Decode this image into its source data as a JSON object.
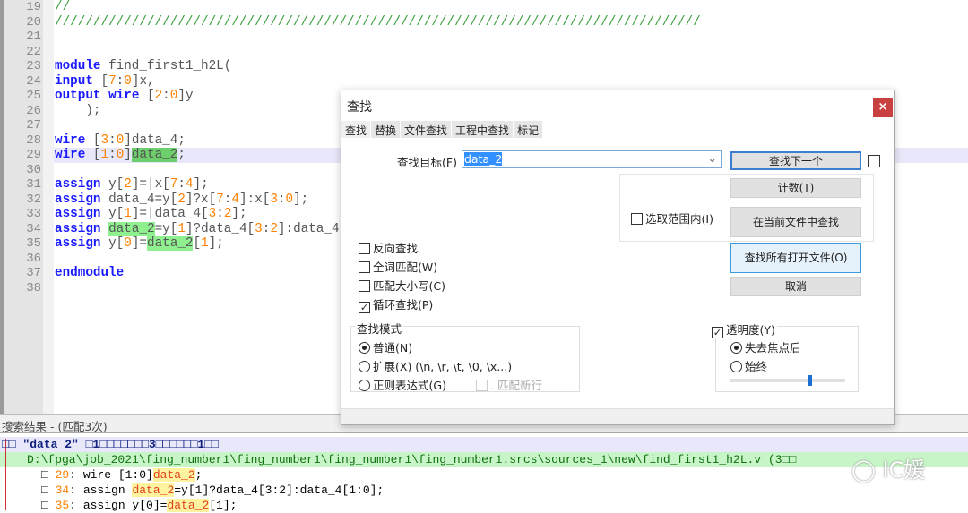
{
  "editor": {
    "line_numbers": [
      "19",
      "20",
      "21",
      "22",
      "23",
      "24",
      "25",
      "26",
      "27",
      "28",
      "29",
      "30",
      "31",
      "32",
      "33",
      "34",
      "35",
      "36",
      "37",
      "38"
    ],
    "lines": [
      [
        [
          "//",
          "cm"
        ]
      ],
      [
        [
          "////////////////////////////////////////////////////////////////////////////////////",
          "cm"
        ]
      ],
      [],
      [],
      [
        [
          "module",
          "kw"
        ],
        [
          " find_first1_h2L(",
          ""
        ]
      ],
      [
        [
          "input",
          "kw"
        ],
        [
          " [",
          ""
        ],
        [
          "7",
          "num"
        ],
        [
          ":",
          ""
        ],
        [
          "0",
          "num"
        ],
        [
          "]x,",
          ""
        ]
      ],
      [
        [
          "output",
          "kw"
        ],
        [
          " ",
          ""
        ],
        [
          "wire",
          "kw"
        ],
        [
          " [",
          ""
        ],
        [
          "2",
          "num"
        ],
        [
          ":",
          ""
        ],
        [
          "0",
          "num"
        ],
        [
          "]y",
          ""
        ]
      ],
      [
        [
          "    );",
          ""
        ]
      ],
      [],
      [
        [
          "wire",
          "kw"
        ],
        [
          " [",
          ""
        ],
        [
          "3",
          "num"
        ],
        [
          ":",
          ""
        ],
        [
          "0",
          "num"
        ],
        [
          "]data_4;",
          ""
        ]
      ],
      [
        [
          "wire",
          "kw"
        ],
        [
          " [",
          ""
        ],
        [
          "1",
          "num"
        ],
        [
          ":",
          ""
        ],
        [
          "0",
          "num"
        ],
        [
          "]",
          ""
        ],
        [
          "data_2",
          "mk"
        ],
        [
          ";",
          ""
        ]
      ],
      [],
      [
        [
          "assign",
          "kw"
        ],
        [
          " y[",
          ""
        ],
        [
          "2",
          "num"
        ],
        [
          "]=|x[",
          ""
        ],
        [
          "7",
          "num"
        ],
        [
          ":",
          ""
        ],
        [
          "4",
          "num"
        ],
        [
          "];",
          ""
        ]
      ],
      [
        [
          "assign",
          "kw"
        ],
        [
          " data_4=y[",
          ""
        ],
        [
          "2",
          "num"
        ],
        [
          "]?x[",
          ""
        ],
        [
          "7",
          "num"
        ],
        [
          ":",
          ""
        ],
        [
          "4",
          "num"
        ],
        [
          "]:x[",
          ""
        ],
        [
          "3",
          "num"
        ],
        [
          ":",
          ""
        ],
        [
          "0",
          "num"
        ],
        [
          "];",
          ""
        ]
      ],
      [
        [
          "assign",
          "kw"
        ],
        [
          " y[",
          ""
        ],
        [
          "1",
          "num"
        ],
        [
          "]=|data_4[",
          ""
        ],
        [
          "3",
          "num"
        ],
        [
          ":",
          ""
        ],
        [
          "2",
          "num"
        ],
        [
          "];",
          ""
        ]
      ],
      [
        [
          "assign",
          "kw"
        ],
        [
          " ",
          ""
        ],
        [
          "data_2",
          "mk2"
        ],
        [
          "=y[",
          ""
        ],
        [
          "1",
          "num"
        ],
        [
          "]?data_4[",
          ""
        ],
        [
          "3",
          "num"
        ],
        [
          ":",
          ""
        ],
        [
          "2",
          "num"
        ],
        [
          "]:data_4[",
          ""
        ],
        [
          "1",
          "num"
        ],
        [
          ":",
          ""
        ],
        [
          "0",
          "num"
        ],
        [
          "];",
          ""
        ]
      ],
      [
        [
          "assign",
          "kw"
        ],
        [
          " y[",
          ""
        ],
        [
          "0",
          "num"
        ],
        [
          "]=",
          ""
        ],
        [
          "data_2",
          "mk2"
        ],
        [
          "[",
          ""
        ],
        [
          "1",
          "num"
        ],
        [
          "];",
          ""
        ]
      ],
      [],
      [
        [
          "endmodule",
          "kw"
        ]
      ],
      []
    ]
  },
  "dialog": {
    "title": "查找",
    "close": "×",
    "tabs": [
      "查找",
      "替换",
      "文件查找",
      "工程中查找",
      "标记"
    ],
    "find_label": "查找目标(F) :",
    "find_value": "data_2",
    "buttons": {
      "find_next": "查找下一个",
      "count": "计数(T)",
      "find_in_current": "在当前文件中查找",
      "find_all_open": "查找所有打开文件(O)",
      "cancel": "取消"
    },
    "in_selection": "选取范围内(I)",
    "options": [
      {
        "label": "反向查找",
        "checked": false
      },
      {
        "label": "全词匹配(W)",
        "checked": false
      },
      {
        "label": "匹配大小写(C)",
        "checked": false
      },
      {
        "label": "循环查找(P)",
        "checked": true
      }
    ],
    "mode": {
      "title": "查找模式",
      "normal": "普通(N)",
      "extended": "扩展(X) (\\n, \\r, \\t, \\0, \\x...)",
      "regex": "正则表达式(G)",
      "dot_newline": ". 匹配新行",
      "selected": "normal"
    },
    "transparency": {
      "label": "透明度(Y)",
      "checked": true,
      "on_lose_focus": "失去焦点后",
      "always": "始终",
      "selected": "on_lose_focus",
      "level": 0.7
    }
  },
  "results": {
    "title": "搜索结果 - (匹配3次)",
    "summary": "□□ \"data_2\" □1□□□□□□□3□□□□□□1□□",
    "file": "D:\\fpga\\job_2021\\fing_number1\\fing_number1\\fing_number1\\fing_number1.srcs\\sources_1\\new\\find_first1_h2L.v (3□□",
    "hits": [
      {
        "line": "29",
        "pre": ": wire [1:0]",
        "match": "data_2",
        "post": ";"
      },
      {
        "line": "34",
        "pre": ": assign ",
        "match": "data_2",
        "post": "=y[1]?data_4[3:2]:data_4[1:0];"
      },
      {
        "line": "35",
        "pre": ": assign y[0]=",
        "match": "data_2",
        "post": "[1];"
      }
    ]
  },
  "watermark": "IC媛"
}
